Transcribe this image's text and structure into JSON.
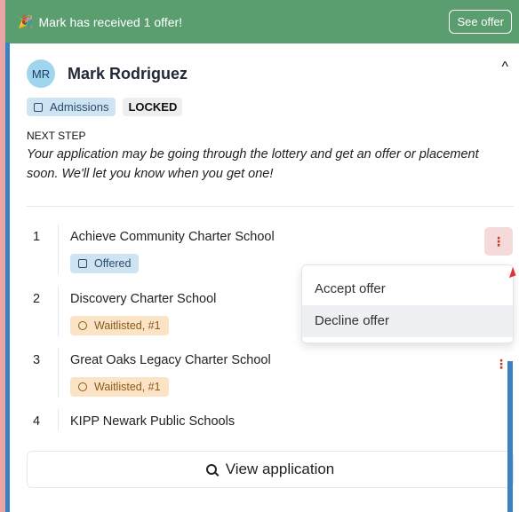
{
  "banner": {
    "icon": "party-popper-icon",
    "message": "Mark has received 1 offer!",
    "button_label": "See offer",
    "color": "#5a9e6f"
  },
  "student": {
    "initials": "MR",
    "name": "Mark Rodriguez"
  },
  "tags": {
    "admissions": "Admissions",
    "locked": "LOCKED"
  },
  "next_step": {
    "label": "NEXT STEP",
    "text": "Your application may be going through the lottery and get an offer or placement soon. We'll let you know when you get one!"
  },
  "schools": [
    {
      "num": "1",
      "name": "Achieve Community Charter School",
      "status": "Offered"
    },
    {
      "num": "2",
      "name": "Discovery Charter School",
      "status": "Waitlisted, #1"
    },
    {
      "num": "3",
      "name": "Great Oaks Legacy Charter School",
      "status": "Waitlisted, #1"
    },
    {
      "num": "4",
      "name": "KIPP Newark Public Schools",
      "status": ""
    }
  ],
  "menu": {
    "accept": "Accept offer",
    "decline": "Decline offer"
  },
  "view_button": "View application",
  "icons": {
    "kebab": "⋮",
    "collapse": "^"
  }
}
